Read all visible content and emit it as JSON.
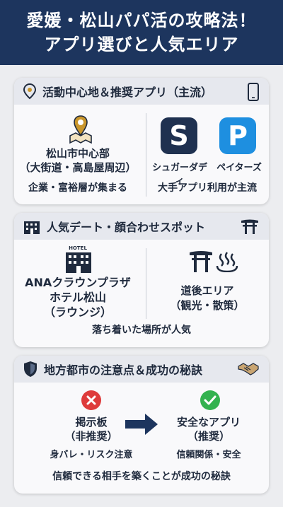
{
  "header": {
    "line1": "愛媛・松山パパ活の攻略法！",
    "line2": "アプリ選びと人気エリア"
  },
  "colors": {
    "header_bg": "#1d355e",
    "navy": "#1f2a3d",
    "sugar_daddy_icon": "#1f3150",
    "paters_icon": "#1e8fe0",
    "red_x": "#de3b3b",
    "green_check": "#33b24f",
    "arrow": "#1d355e"
  },
  "card1": {
    "title": "活動中心地＆推奨アプリ（主流）",
    "title_icon": "map-pin-icon",
    "right_icon": "smartphone-icon",
    "area_line1": "松山市中心部",
    "area_line2": "（大街道・高島屋周辺）",
    "area_note": "企業・富裕層が集まる",
    "app1_letter": "S",
    "app1_name": "シュガーダディ",
    "app2_letter": "P",
    "app2_name": "ペイターズ",
    "apps_note": "大手アプリ利用が主流"
  },
  "card2": {
    "title": "人気デート・顔合わせスポット",
    "title_icon": "hotel-icon",
    "right_icon": "torii-icon",
    "hotel_sign": "HOTEL",
    "spot1_line1": "ANAクラウンプラザ",
    "spot1_line2": "ホテル松山",
    "spot1_line3": "（ラウンジ）",
    "spot2_line1": "道後エリア",
    "spot2_line2": "（観光・散策）",
    "note": "落ち着いた場所が人気"
  },
  "card3": {
    "title": "地方都市の注意点＆成功の秘訣",
    "title_icon": "shield-icon",
    "right_icon": "handshake-icon",
    "bad_line1": "掲示板",
    "bad_line2": "（非推奨）",
    "bad_note": "身バレ・リスク注意",
    "good_line1": "安全なアプリ",
    "good_line2": "（推奨）",
    "good_note": "信頼関係・安全",
    "footer": "信頼できる相手を築くことが成功の秘訣"
  }
}
